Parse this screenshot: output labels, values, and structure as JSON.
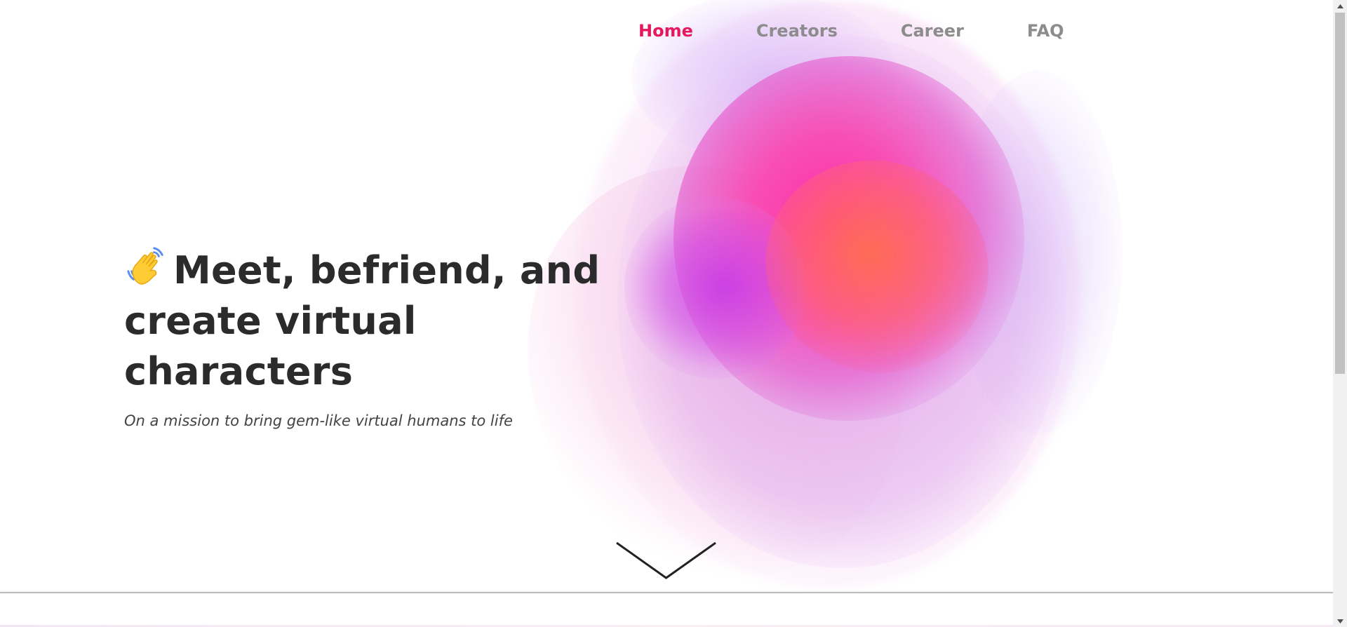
{
  "nav": {
    "items": [
      {
        "label": "Home",
        "active": true
      },
      {
        "label": "Creators",
        "active": false
      },
      {
        "label": "Career",
        "active": false
      },
      {
        "label": "FAQ",
        "active": false
      }
    ],
    "active_color": "#e6195e",
    "inactive_color": "#8c8c8c"
  },
  "hero": {
    "icon": "waving-hand-icon",
    "title_line1": "Meet, befriend, and",
    "title_line2": "create virtual characters",
    "subtitle": "On a mission to bring gem-like virtual humans to life"
  },
  "scroll_indicator": {
    "icon": "chevron-down-icon"
  },
  "colors": {
    "text_dark": "#2b2b2b",
    "blob_pink": "#ff28a0",
    "blob_orange": "#ff6e50",
    "blob_purple": "#c83ce6"
  }
}
